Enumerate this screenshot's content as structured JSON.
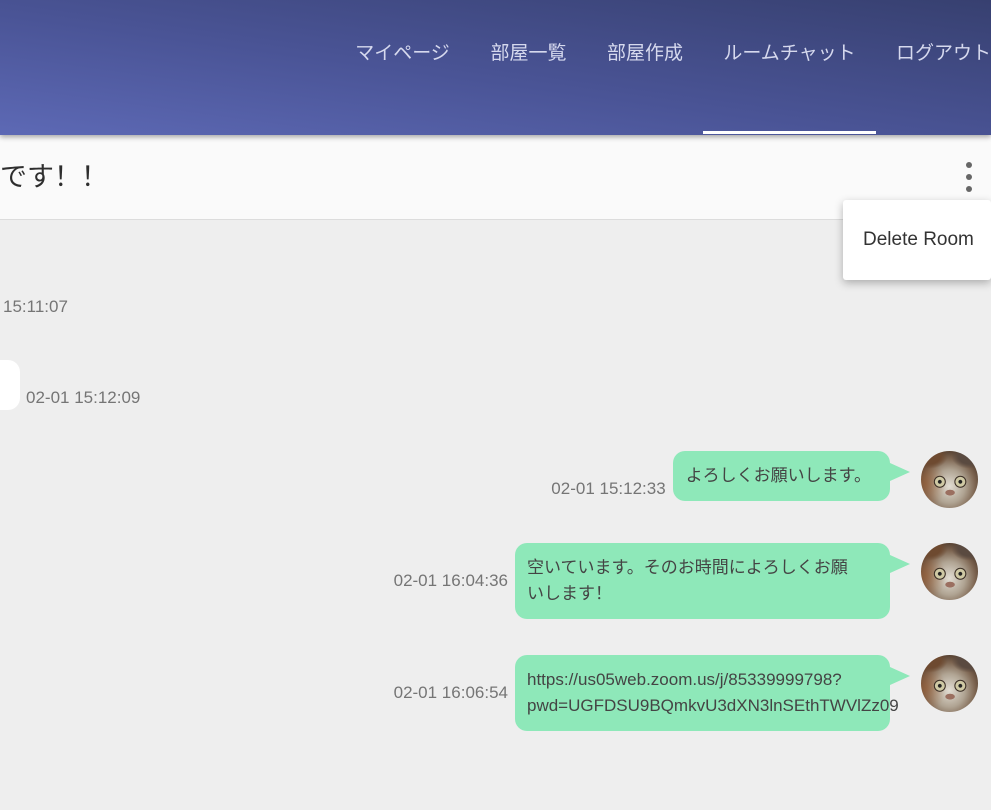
{
  "header": {
    "nav": [
      {
        "label": "マイページ",
        "active": false
      },
      {
        "label": "部屋一覧",
        "active": false
      },
      {
        "label": "部屋作成",
        "active": false
      },
      {
        "label": "ルームチャット",
        "active": true
      },
      {
        "label": "ログアウト",
        "active": false
      }
    ]
  },
  "room": {
    "title": "です！！",
    "options_icon": "more-vert-icon",
    "options_menu": [
      {
        "label": "Delete Room"
      }
    ]
  },
  "chat": {
    "incoming": [
      {
        "time": "15:11:07"
      },
      {
        "time": "02-01 15:12:09"
      }
    ],
    "outgoing": [
      {
        "time": "02-01 15:12:33",
        "text": "よろしくお願いします。",
        "avatar": "cat-photo-avatar"
      },
      {
        "time": "02-01 16:04:36",
        "text": "空いています。そのお時間によろしくお願いします！",
        "avatar": "cat-photo-avatar"
      },
      {
        "time": "02-01 16:06:54",
        "text": "https://us05web.zoom.us/j/85339999798?pwd=UGFDSU9BQmkvU3dXN3lnSEthTWVlZz09",
        "avatar": "cat-photo-avatar"
      }
    ]
  },
  "colors": {
    "header_light": "#5d69b5",
    "header_dark": "#374070",
    "outgoing_bubble": "#8ee8b9",
    "incoming_bubble": "#ffffff",
    "chat_background": "#eeeeee",
    "title_bar": "#fafafa"
  }
}
